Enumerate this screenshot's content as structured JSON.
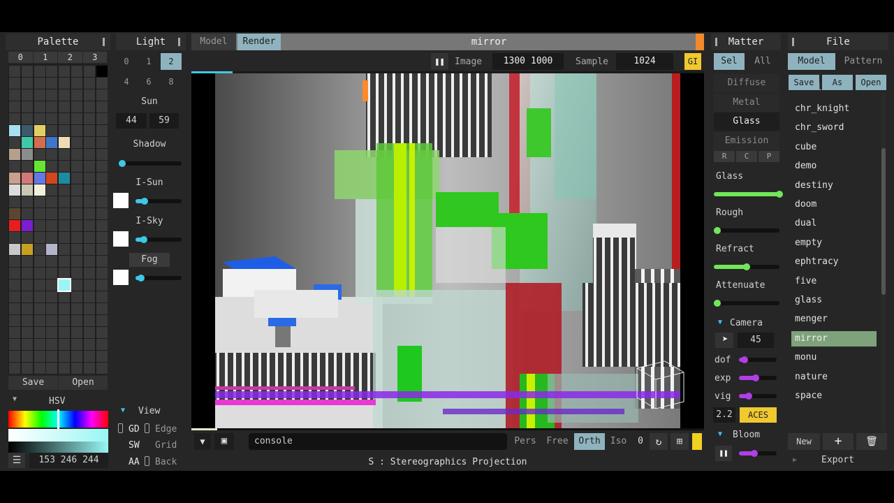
{
  "palette": {
    "title": "Palette",
    "tabs": [
      "0",
      "1",
      "2",
      "3"
    ],
    "save": "Save",
    "open": "Open",
    "hsv_label": "HSV",
    "color_value": "153 246 244",
    "colors": [
      {
        "r": 5,
        "c": 0,
        "hex": "#a8dff0"
      },
      {
        "r": 5,
        "c": 1,
        "hex": "#3c5a6c"
      },
      {
        "r": 5,
        "c": 2,
        "hex": "#e2cf62"
      },
      {
        "r": 6,
        "c": 1,
        "hex": "#3fc9a9"
      },
      {
        "r": 6,
        "c": 2,
        "hex": "#d26e4e"
      },
      {
        "r": 6,
        "c": 3,
        "hex": "#3f76c9"
      },
      {
        "r": 6,
        "c": 4,
        "hex": "#f0dcb4"
      },
      {
        "r": 7,
        "c": 0,
        "hex": "#b4a08c"
      },
      {
        "r": 7,
        "c": 1,
        "hex": "#8c8c8c"
      },
      {
        "r": 8,
        "c": 2,
        "hex": "#64e632"
      },
      {
        "r": 9,
        "c": 0,
        "hex": "#c8a08c"
      },
      {
        "r": 9,
        "c": 1,
        "hex": "#d27878"
      },
      {
        "r": 9,
        "c": 2,
        "hex": "#6478e6"
      },
      {
        "r": 9,
        "c": 3,
        "hex": "#d24620"
      },
      {
        "r": 9,
        "c": 4,
        "hex": "#1e8ca0"
      },
      {
        "r": 10,
        "c": 0,
        "hex": "#dcdcdc"
      },
      {
        "r": 10,
        "c": 1,
        "hex": "#c8c8b4"
      },
      {
        "r": 10,
        "c": 2,
        "hex": "#f0f0dc"
      },
      {
        "r": 12,
        "c": 0,
        "hex": "#5a4632"
      },
      {
        "r": 13,
        "c": 0,
        "hex": "#e61e1e"
      },
      {
        "r": 13,
        "c": 1,
        "hex": "#7a1ecf"
      },
      {
        "r": 15,
        "c": 0,
        "hex": "#c8c8c8"
      },
      {
        "r": 15,
        "c": 1,
        "hex": "#c8a020"
      },
      {
        "r": 15,
        "c": 3,
        "hex": "#b4b4c8"
      }
    ],
    "selected_color": "#99f6f4"
  },
  "light": {
    "title": "Light",
    "tabs_row1": [
      "0",
      "1",
      "2"
    ],
    "tabs_row2": [
      "4",
      "6",
      "8"
    ],
    "active_tab": "2",
    "sun_label": "Sun",
    "sun_a": "44",
    "sun_b": "59",
    "shadow_label": "Shadow",
    "isun_label": "I-Sun",
    "isky_label": "I-Sky",
    "fog_label": "Fog",
    "shadow_level": 0.0,
    "isun_level": 0.2,
    "isky_level": 0.18,
    "fog_level": 0.12
  },
  "view": {
    "title": "View",
    "gd": "GD",
    "edge": "Edge",
    "sw": "SW",
    "grid": "Grid",
    "aa": "AA",
    "back": "Back"
  },
  "viewport": {
    "tab_model": "Model",
    "tab_render": "Render",
    "title": "mirror",
    "image_label": "Image",
    "image_w": "1300",
    "image_h": "1000",
    "sample_label": "Sample",
    "sample_value": "1024",
    "gi": "GI",
    "console": "console",
    "proj": [
      "Pers",
      "Free",
      "Orth",
      "Iso"
    ],
    "active_proj": "Orth",
    "proj_num": "0",
    "status": "S : Stereographics Projection",
    "progress": 0.08,
    "bottom_progress": 0.05
  },
  "matter": {
    "title": "Matter",
    "sel": "Sel",
    "all": "All",
    "types": [
      "Diffuse",
      "Metal",
      "Glass",
      "Emission"
    ],
    "active_type": "Glass",
    "rcp": [
      "R",
      "C",
      "P"
    ],
    "glass_label": "Glass",
    "rough_label": "Rough",
    "refract_label": "Refract",
    "attenuate_label": "Attenuate",
    "glass_level": 1.0,
    "rough_level": 0.02,
    "refract_level": 0.5,
    "attenuate_level": 0.05,
    "camera_label": "Camera",
    "fov": "45",
    "dof_label": "dof",
    "exp_label": "exp",
    "vig_label": "vig",
    "dof_level": 0.15,
    "exp_level": 0.45,
    "vig_level": 0.25,
    "gamma": "2.2",
    "tonemap": "ACES",
    "bloom_label": "Bloom",
    "bloom_level": 0.4
  },
  "file": {
    "title": "File",
    "tab_model": "Model",
    "tab_pattern": "Pattern",
    "save": "Save",
    "as": "As",
    "open": "Open",
    "items": [
      "chr_knight",
      "chr_sword",
      "cube",
      "demo",
      "destiny",
      "doom",
      "dual",
      "empty",
      "ephtracy",
      "five",
      "glass",
      "menger",
      "mirror",
      "monu",
      "nature",
      "space"
    ],
    "selected": "mirror",
    "new": "New",
    "export": "Export"
  }
}
